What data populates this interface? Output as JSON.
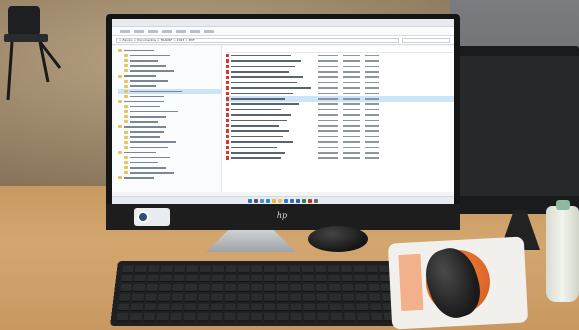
{
  "screen": {
    "window_title": "",
    "address_path": "> Equipo > Documentos > TRANSF > 2023 > PDF",
    "nav_items_count_hint": 26,
    "file_rows_count_hint": 20,
    "clock": ""
  },
  "brand": "hp",
  "colors": {
    "desk": "#d3a670",
    "monitor_bezel": "#151515",
    "mousepad_accent": "#e06a2a",
    "explorer_selection": "#cce4f7"
  },
  "taskbar_icons": [
    "start-icon",
    "search-icon",
    "files-icon",
    "edge-icon",
    "chrome-icon",
    "folder-icon",
    "mail-icon",
    "store-icon",
    "word-icon",
    "excel-icon",
    "pdf-icon",
    "settings-icon"
  ]
}
